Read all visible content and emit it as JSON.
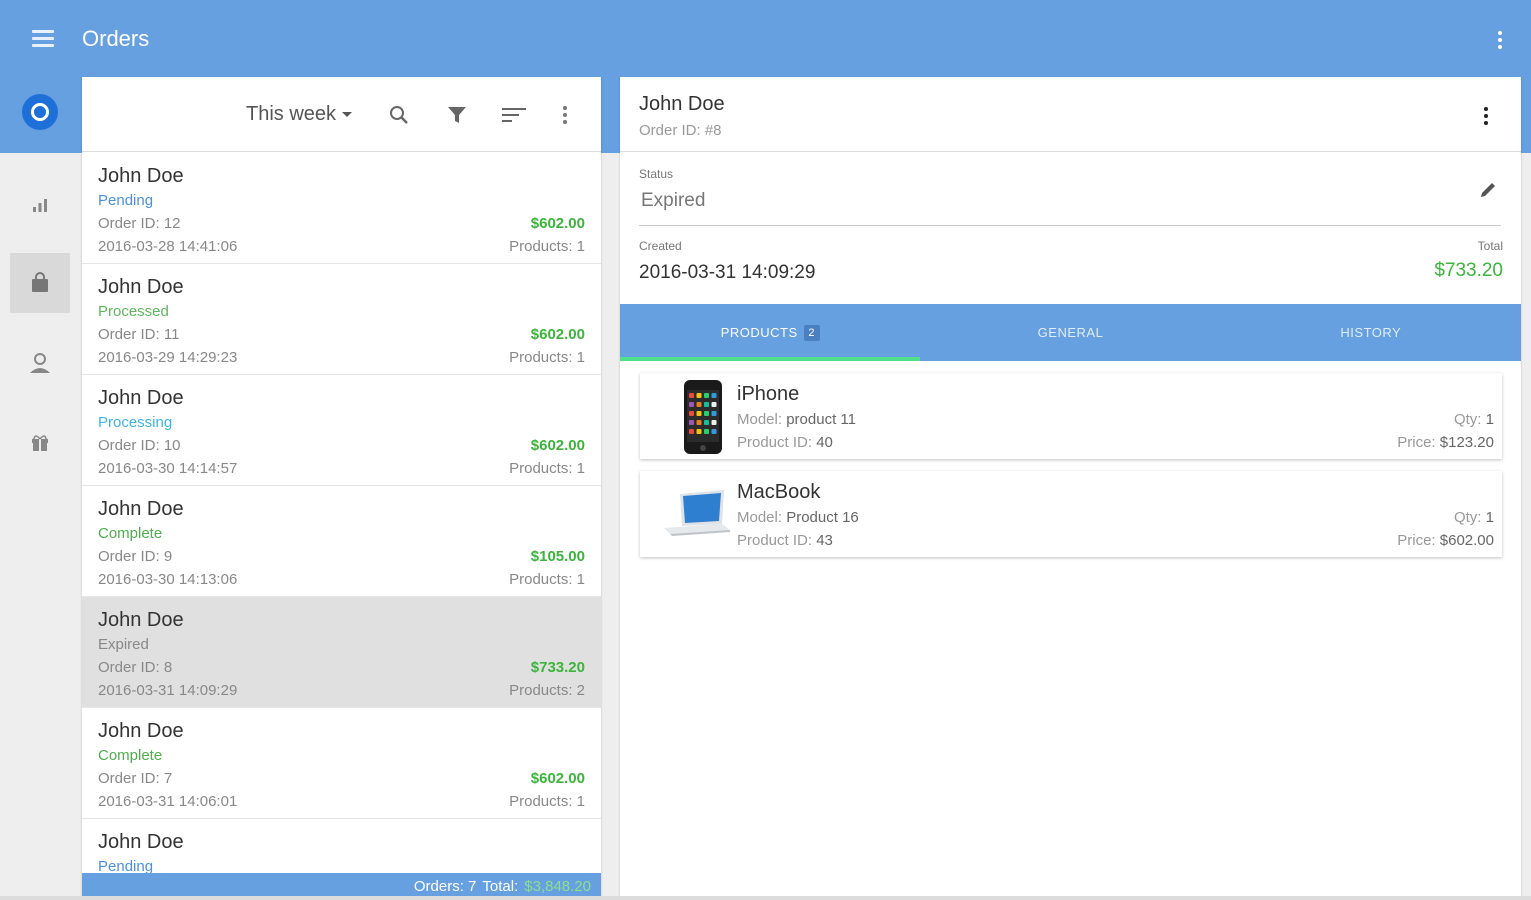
{
  "app": {
    "title": "Orders",
    "menu_icon": "hamburger-menu-icon",
    "overflow_icon": "more-vert-icon"
  },
  "rail": {
    "items": [
      {
        "name": "statistics",
        "icon": "bar-chart-icon",
        "active": false
      },
      {
        "name": "orders",
        "icon": "shopping-bag-icon",
        "active": true
      },
      {
        "name": "customers",
        "icon": "person-icon",
        "active": false
      },
      {
        "name": "products",
        "icon": "gift-box-icon",
        "active": false
      }
    ]
  },
  "list": {
    "period_filter": "This week",
    "orders": [
      {
        "name": "John Doe",
        "status": "Pending",
        "order_id": "Order ID: 12",
        "date": "2016-03-28 14:41:06",
        "amount": "$602.00",
        "products": "Products: 1"
      },
      {
        "name": "John Doe",
        "status": "Processed",
        "order_id": "Order ID: 11",
        "date": "2016-03-29 14:29:23",
        "amount": "$602.00",
        "products": "Products: 1"
      },
      {
        "name": "John Doe",
        "status": "Processing",
        "order_id": "Order ID: 10",
        "date": "2016-03-30 14:14:57",
        "amount": "$602.00",
        "products": "Products: 1"
      },
      {
        "name": "John Doe",
        "status": "Complete",
        "order_id": "Order ID: 9",
        "date": "2016-03-30 14:13:06",
        "amount": "$105.00",
        "products": "Products: 1"
      },
      {
        "name": "John Doe",
        "status": "Expired",
        "order_id": "Order ID: 8",
        "date": "2016-03-31 14:09:29",
        "amount": "$733.20",
        "products": "Products: 2"
      },
      {
        "name": "John Doe",
        "status": "Complete",
        "order_id": "Order ID: 7",
        "date": "2016-03-31 14:06:01",
        "amount": "$602.00",
        "products": "Products: 1"
      },
      {
        "name": "John Doe",
        "status": "Pending",
        "order_id": "",
        "date": "",
        "amount": "",
        "products": ""
      }
    ],
    "selected_index": 4,
    "footer": {
      "orders_label": "Orders: 7",
      "total_label": "Total:",
      "total_value": "$3,848.20"
    }
  },
  "detail": {
    "customer": "John Doe",
    "order_id": "Order ID: #8",
    "status_label": "Status",
    "status_value": "Expired",
    "created_label": "Created",
    "created_value": "2016-03-31 14:09:29",
    "total_label": "Total",
    "total_value": "$733.20",
    "tabs": [
      {
        "label": "PRODUCTS",
        "badge": "2",
        "active": true
      },
      {
        "label": "GENERAL",
        "badge": "",
        "active": false
      },
      {
        "label": "HISTORY",
        "badge": "",
        "active": false
      }
    ],
    "products": [
      {
        "name": "iPhone",
        "model_label": "Model:",
        "model": "product 11",
        "id_label": "Product ID:",
        "id": "40",
        "qty_label": "Qty:",
        "qty": "1",
        "price_label": "Price:",
        "price": "$123.20",
        "icon": "iphone-image"
      },
      {
        "name": "MacBook",
        "model_label": "Model:",
        "model": "Product 16",
        "id_label": "Product ID:",
        "id": "43",
        "qty_label": "Qty:",
        "qty": "1",
        "price_label": "Price:",
        "price": "$602.00",
        "icon": "macbook-image"
      }
    ]
  },
  "colors": {
    "primary": "#66a0e0",
    "accent_green": "#3cb43c",
    "tab_indicator": "#4ee08a"
  }
}
